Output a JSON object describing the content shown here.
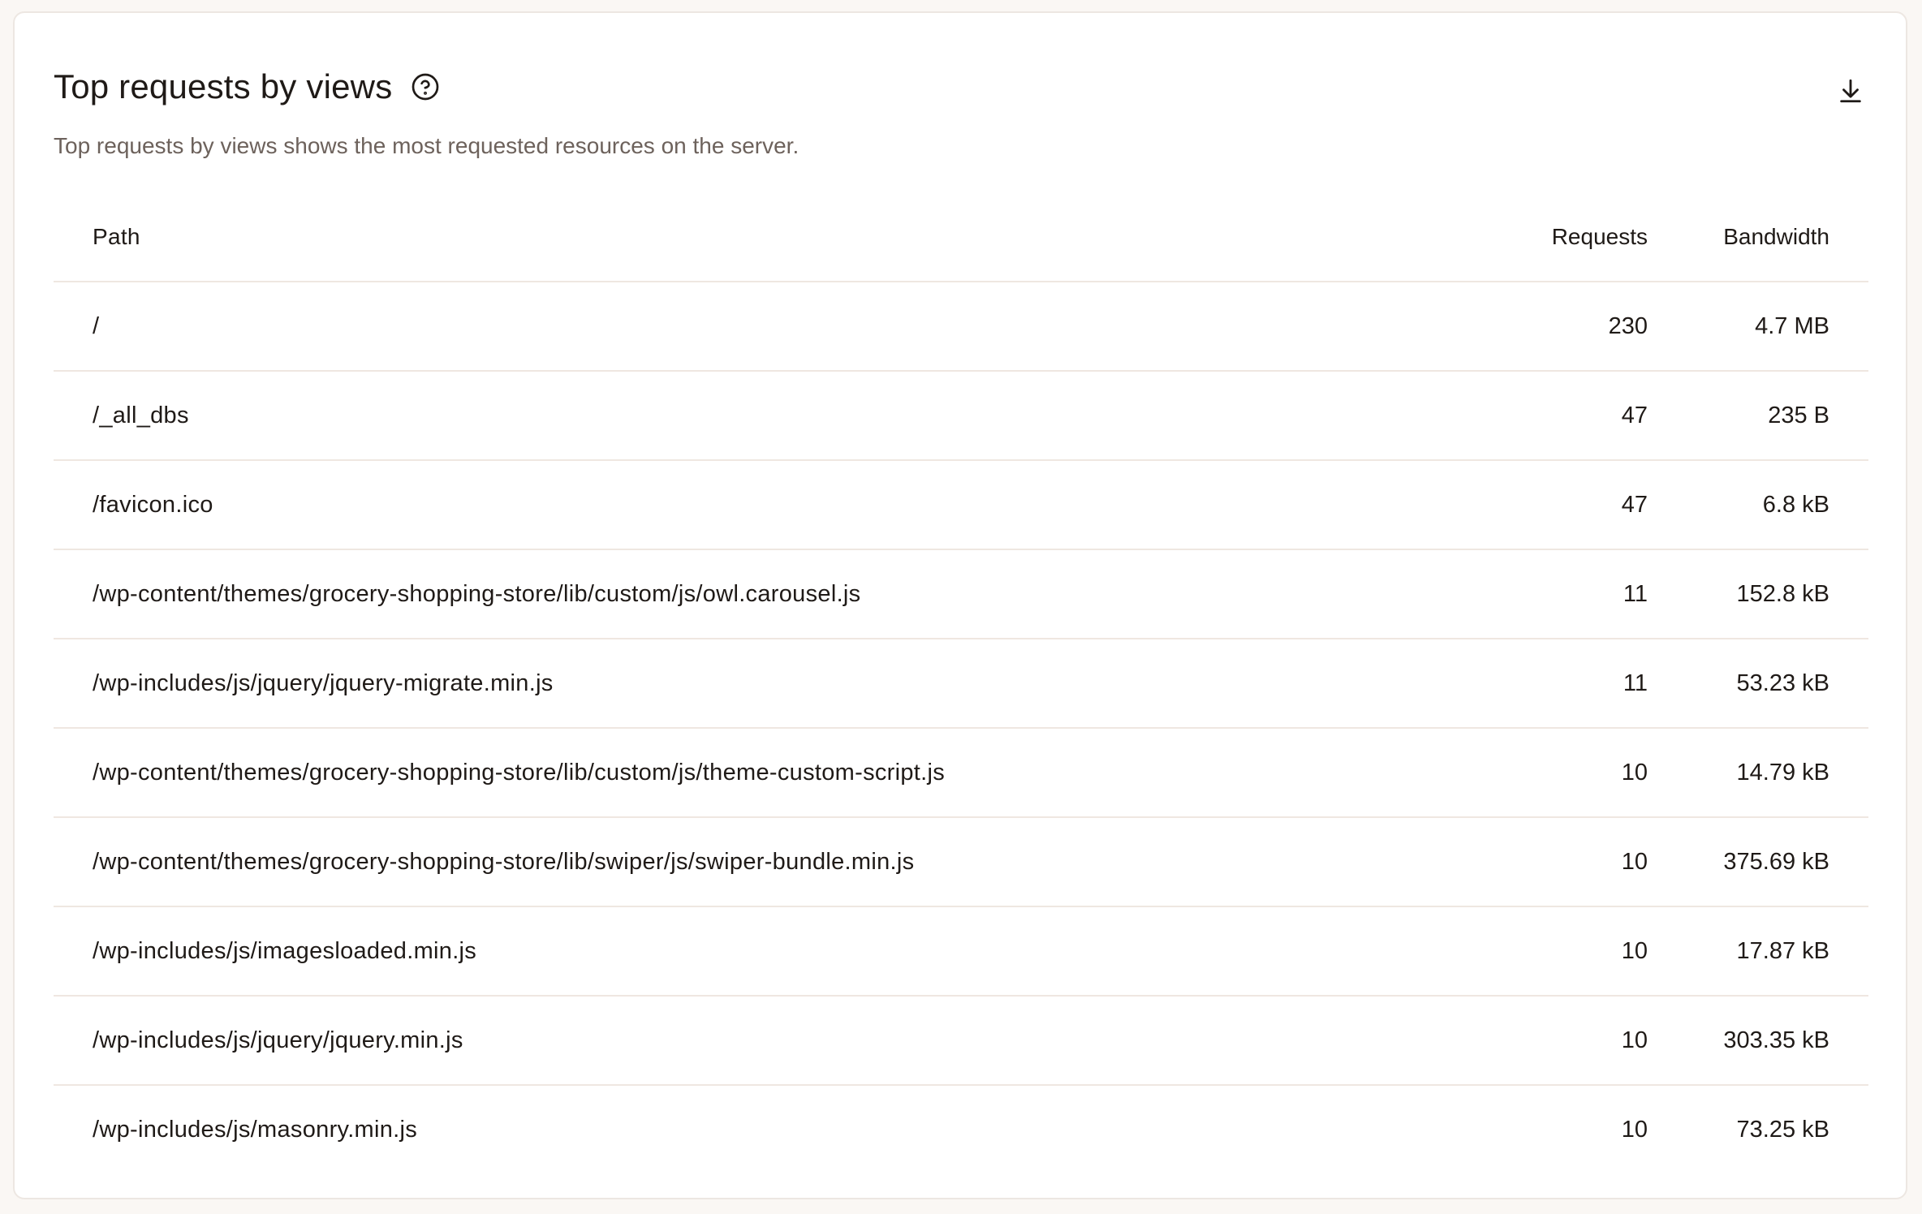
{
  "card": {
    "title": "Top requests by views",
    "subtitle": "Top requests by views shows the most requested resources on the server.",
    "icons": {
      "help": "help-circle-icon",
      "download": "download-icon"
    }
  },
  "table": {
    "headers": {
      "path": "Path",
      "requests": "Requests",
      "bandwidth": "Bandwidth"
    },
    "rows": [
      {
        "path": "/",
        "requests": "230",
        "bandwidth": "4.7 MB"
      },
      {
        "path": "/_all_dbs",
        "requests": "47",
        "bandwidth": "235 B"
      },
      {
        "path": "/favicon.ico",
        "requests": "47",
        "bandwidth": "6.8 kB"
      },
      {
        "path": "/wp-content/themes/grocery-shopping-store/lib/custom/js/owl.carousel.js",
        "requests": "11",
        "bandwidth": "152.8 kB"
      },
      {
        "path": "/wp-includes/js/jquery/jquery-migrate.min.js",
        "requests": "11",
        "bandwidth": "53.23 kB"
      },
      {
        "path": "/wp-content/themes/grocery-shopping-store/lib/custom/js/theme-custom-script.js",
        "requests": "10",
        "bandwidth": "14.79 kB"
      },
      {
        "path": "/wp-content/themes/grocery-shopping-store/lib/swiper/js/swiper-bundle.min.js",
        "requests": "10",
        "bandwidth": "375.69 kB"
      },
      {
        "path": "/wp-includes/js/imagesloaded.min.js",
        "requests": "10",
        "bandwidth": "17.87 kB"
      },
      {
        "path": "/wp-includes/js/jquery/jquery.min.js",
        "requests": "10",
        "bandwidth": "303.35 kB"
      },
      {
        "path": "/wp-includes/js/masonry.min.js",
        "requests": "10",
        "bandwidth": "73.25 kB"
      }
    ]
  }
}
